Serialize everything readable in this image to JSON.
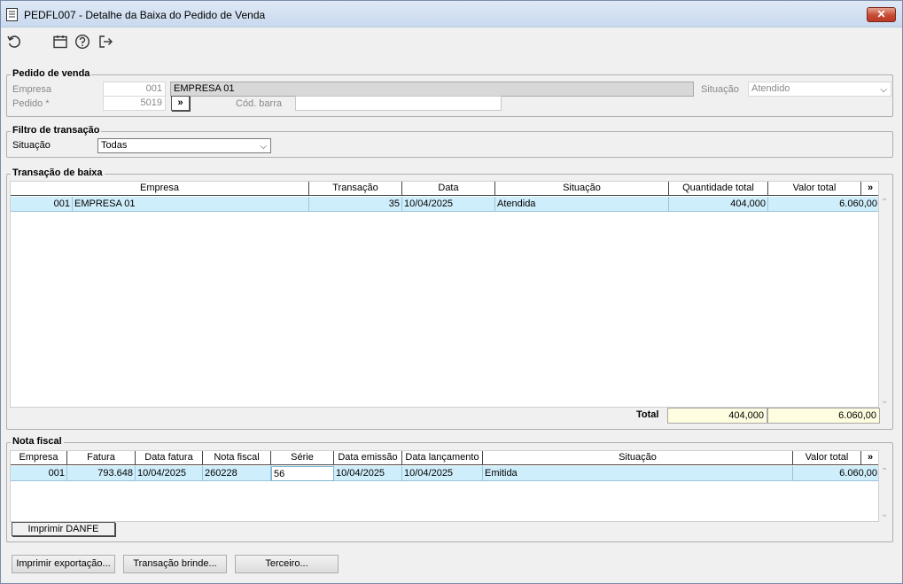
{
  "window": {
    "title": "PEDFL007 - Detalhe da Baixa do Pedido de Venda",
    "close_label": "✕"
  },
  "toolbar": {
    "icons": [
      "refresh-icon",
      "calendar-icon",
      "help-icon",
      "exit-icon"
    ]
  },
  "pedido": {
    "legend": "Pedido de venda",
    "empresa_label": "Empresa",
    "empresa_code": "001",
    "empresa_name": "EMPRESA 01",
    "pedido_label": "Pedido *",
    "pedido_value": "5019",
    "lookup_label": "»",
    "cod_barra_label": "Cód. barra",
    "cod_barra_value": "",
    "situacao_label": "Situação",
    "situacao_value": "Atendido"
  },
  "filtro": {
    "legend": "Filtro de transação",
    "situacao_label": "Situação",
    "situacao_value": "Todas"
  },
  "transacao": {
    "legend": "Transação de baixa",
    "columns": [
      "Empresa",
      "Transação",
      "Data",
      "Situação",
      "Quantidade total",
      "Valor total"
    ],
    "more_label": "»",
    "rows": [
      {
        "empresa_code": "001",
        "empresa_name": "EMPRESA 01",
        "transacao": "35",
        "data": "10/04/2025",
        "situacao": "Atendida",
        "quantidade": "404,000",
        "valor": "6.060,00"
      }
    ],
    "total_label": "Total",
    "total_quantidade": "404,000",
    "total_valor": "6.060,00"
  },
  "nota": {
    "legend": "Nota fiscal",
    "columns": [
      "Empresa",
      "Fatura",
      "Data fatura",
      "Nota fiscal",
      "Série",
      "Data emissão",
      "Data lançamento",
      "Situação",
      "Valor total"
    ],
    "more_label": "»",
    "rows": [
      {
        "empresa": "001",
        "fatura": "793.648",
        "data_fatura": "10/04/2025",
        "nota_fiscal": "260228",
        "serie": "56",
        "data_emissao": "10/04/2025",
        "data_lancamento": "10/04/2025",
        "situacao": "Emitida",
        "valor": "6.060,00"
      }
    ],
    "imprimir_danfe": "Imprimir DANFE"
  },
  "footer": {
    "imprimir_exportacao": "Imprimir exportação...",
    "transacao_brinde": "Transação brinde...",
    "terceiro": "Terceiro..."
  }
}
